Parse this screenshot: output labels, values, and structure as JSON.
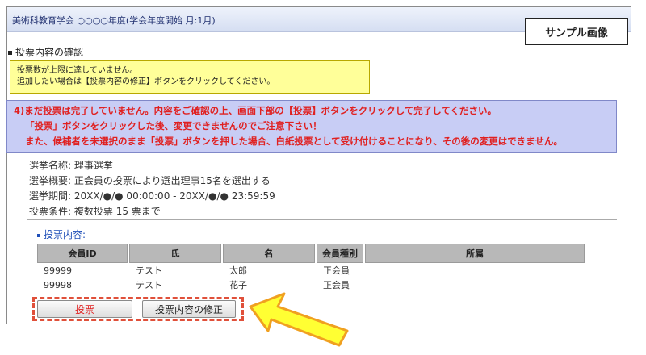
{
  "window": {
    "title": "美術科教育学会 ○○○○年度(学会年度開始 月:1月)"
  },
  "sample_label": "サンプル画像",
  "section": {
    "heading": "投票内容の確認"
  },
  "notice": {
    "lines": [
      "投票数が上限に達していません。",
      "追加したい場合は【投票内容の修正】ボタンをクリックしてください。"
    ]
  },
  "warning": {
    "lines": [
      "4)まだ投票は完了していません。内容をご確認の上、画面下部の【投票】ボタンをクリックして完了してください。",
      "「投票」ボタンをクリックした後、変更できませんのでご注意下さい！",
      "また、候補者を未選択のまま「投票」ボタンを押した場合、白紙投票として受け付けることになり、その後の変更はできません。"
    ]
  },
  "election": {
    "name_label": "選挙名称:",
    "name": "理事選挙",
    "summary_label": "選挙概要:",
    "summary": "正会員の投票により選出理事15名を選出する",
    "period_label": "選挙期間:",
    "period": "20XX/●/● 00:00:00 - 20XX/●/● 23:59:59",
    "condition_label": "投票条件:",
    "condition": "複数投票 15 票まで"
  },
  "vote": {
    "heading": "投票内容:",
    "columns": [
      "会員ID",
      "氏",
      "名",
      "会員種別",
      "所属"
    ],
    "rows": [
      [
        "99999",
        "テスト",
        "太郎",
        "正会員",
        ""
      ],
      [
        "99998",
        "テスト",
        "花子",
        "正会員",
        ""
      ]
    ]
  },
  "buttons": {
    "vote": "投票",
    "modify": "投票内容の修正"
  },
  "colors": {
    "notice_bg": "#ffff99",
    "warning_bg": "#c8cdf5",
    "warning_text": "#e02020",
    "highlight": "#e0503a",
    "arrow_fill": "#ffff33"
  }
}
